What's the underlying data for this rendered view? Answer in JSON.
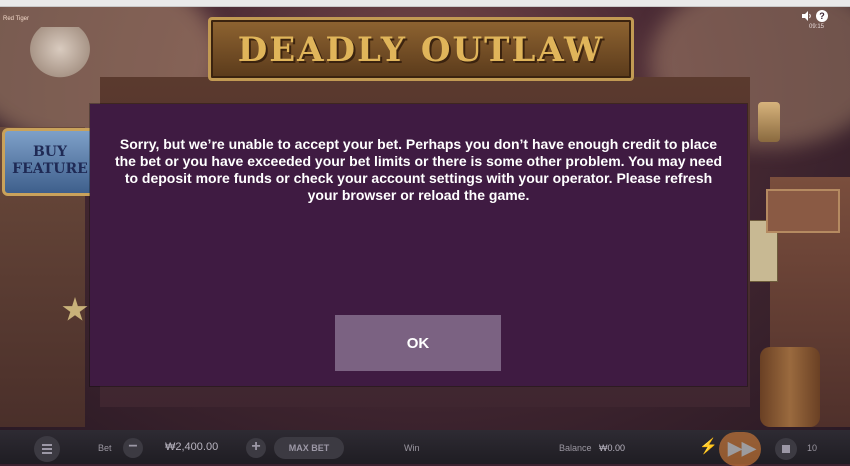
{
  "header": {
    "studio": "Red Tiger",
    "clock": "09:15",
    "icons": [
      "sound-icon",
      "help-icon"
    ],
    "game_title": "DEADLY OUTLAW"
  },
  "buy_feature": {
    "label": "BUY FEATURE"
  },
  "dialog": {
    "message": "Sorry, but we’re unable to accept your bet. Perhaps you don’t have enough credit to place the bet or you have exceeded your bet limits or there is some other problem. You may need to deposit more funds or check your account settings with your operator. Please refresh your browser or reload the game.",
    "ok_label": "OK",
    "background": "#3f1b42",
    "button_color": "#7b6282"
  },
  "controls": {
    "bet_label": "Bet",
    "bet_value": "₩2,400.00",
    "minus": "−",
    "plus": "+",
    "max_bet_label": "MAX BET",
    "win_label": "Win",
    "balance_label": "Balance",
    "balance_value": "₩0.00",
    "autoplay_count": "10",
    "spin_glyph": "▶▶",
    "turbo_glyph": "⚡"
  }
}
